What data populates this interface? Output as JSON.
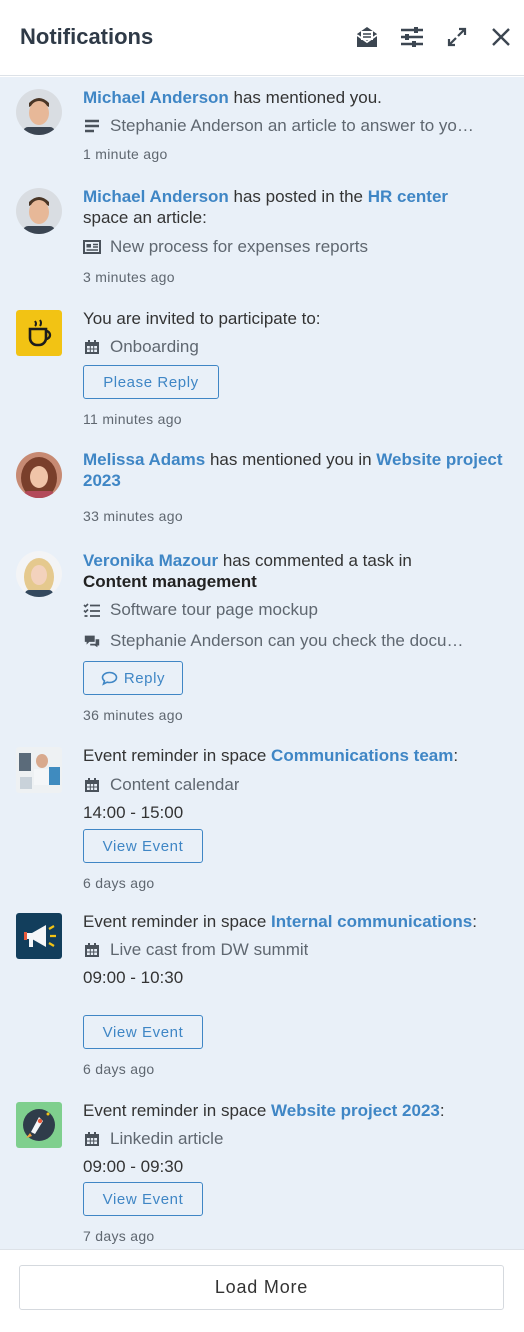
{
  "header": {
    "title": "Notifications",
    "icons": [
      "mark-all-read-icon",
      "settings-sliders-icon",
      "expand-icon",
      "close-icon"
    ]
  },
  "colors": {
    "link": "#3f86c5",
    "list_bg": "#e9f0f8",
    "muted": "#5f6770"
  },
  "notifications": [
    {
      "user": "Michael Anderson",
      "text": " has mentioned you.",
      "detail": "Stephanie Anderson an article to answer to yo…",
      "detail_icon": "text-lines-icon",
      "time": "1 minute ago"
    },
    {
      "user": "Michael Anderson",
      "text_a": " has posted  in the ",
      "space": "HR center",
      "text_b": " space an article:",
      "detail": "New process for expenses reports",
      "detail_icon": "newspaper-icon",
      "time": "3 minutes ago"
    },
    {
      "text": "You are invited to participate to:",
      "detail": "Onboarding",
      "detail_icon": "calendar-icon",
      "button": "Please Reply",
      "time": "11 minutes ago"
    },
    {
      "user": "Melissa Adams",
      "text": " has mentioned you in ",
      "space": "Website project 2023",
      "time": "33 minutes ago"
    },
    {
      "user": "Veronika Mazour",
      "text": " has commented a task in ",
      "project": "Content management",
      "detail": "Software tour page mockup",
      "detail_icon": "task-list-icon",
      "comment": "Stephanie Anderson can you check the docu…",
      "comment_icon": "comments-icon",
      "button": "Reply",
      "button_icon": "comment-icon",
      "time": "36 minutes ago"
    },
    {
      "text": "Event reminder in space ",
      "space": "Communications team",
      "suffix": ":",
      "detail": "Content calendar",
      "detail_icon": "calendar-icon",
      "hours": "14:00 - 15:00",
      "button": "View Event",
      "time": "6 days ago"
    },
    {
      "text": "Event reminder in space ",
      "space": "Internal communications",
      "suffix": ":",
      "detail": "Live cast from DW summit",
      "detail_icon": "calendar-icon",
      "hours": "09:00 - 10:30",
      "button": "View Event",
      "time": "6 days ago"
    },
    {
      "text": "Event reminder in space ",
      "space": "Website project 2023",
      "suffix": ":",
      "detail": "Linkedin article",
      "detail_icon": "calendar-icon",
      "hours": "09:00 - 09:30",
      "button": "View Event",
      "time": "7 days ago"
    }
  ],
  "footer": {
    "load_more": "Load More"
  }
}
